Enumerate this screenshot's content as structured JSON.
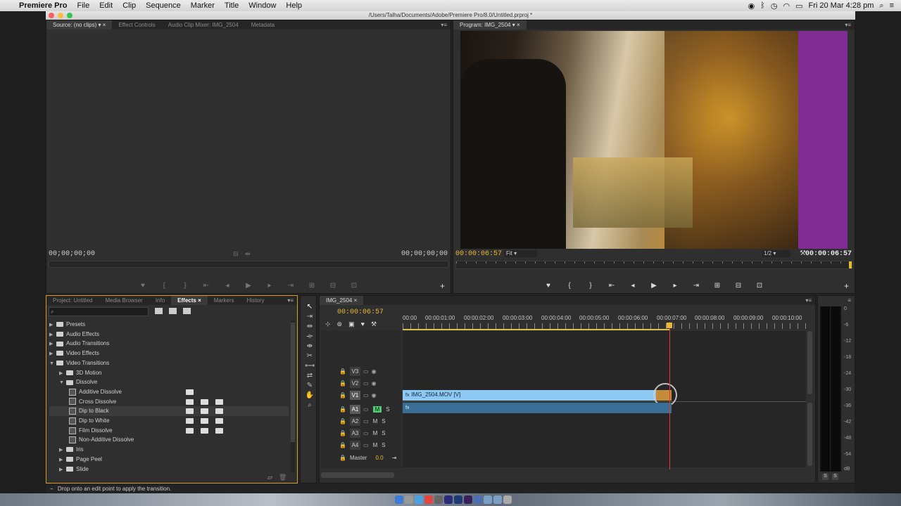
{
  "menubar": {
    "app": "Premiere Pro",
    "items": [
      "File",
      "Edit",
      "Clip",
      "Sequence",
      "Marker",
      "Title",
      "Window",
      "Help"
    ],
    "datetime": "Fri 20 Mar  4:28 pm"
  },
  "window_title": "/Users/Talha/Documents/Adobe/Premiere Pro/8.0/Untitled.prproj *",
  "source_panel": {
    "tabs": [
      "Source: (no clips)",
      "Effect Controls",
      "Audio Clip Mixer: IMG_2504",
      "Metadata"
    ],
    "timecode_in": "00;00;00;00",
    "timecode_out": "00;00;00;00"
  },
  "program_panel": {
    "tab": "Program: IMG_2504",
    "timecode_current": "00:00:06:57",
    "zoom": "Fit",
    "resolution": "1/2",
    "timecode_duration": "00:00:06:57"
  },
  "project_panel": {
    "tabs": [
      "Project: Untitled",
      "Media Browser",
      "Info",
      "Effects",
      "Markers",
      "History"
    ],
    "search_placeholder": "",
    "tree": [
      {
        "label": "Presets",
        "level": 0,
        "expanded": false,
        "type": "folder"
      },
      {
        "label": "Audio Effects",
        "level": 0,
        "expanded": false,
        "type": "folder"
      },
      {
        "label": "Audio Transitions",
        "level": 0,
        "expanded": false,
        "type": "folder"
      },
      {
        "label": "Video Effects",
        "level": 0,
        "expanded": false,
        "type": "folder"
      },
      {
        "label": "Video Transitions",
        "level": 0,
        "expanded": true,
        "type": "folder"
      },
      {
        "label": "3D Motion",
        "level": 1,
        "expanded": false,
        "type": "folder"
      },
      {
        "label": "Dissolve",
        "level": 1,
        "expanded": true,
        "type": "folder"
      },
      {
        "label": "Additive Dissolve",
        "level": 2,
        "type": "effect",
        "badges": 1
      },
      {
        "label": "Cross Dissolve",
        "level": 2,
        "type": "effect",
        "badges": 3
      },
      {
        "label": "Dip to Black",
        "level": 2,
        "type": "effect",
        "badges": 3,
        "selected": true
      },
      {
        "label": "Dip to White",
        "level": 2,
        "type": "effect",
        "badges": 3
      },
      {
        "label": "Film Dissolve",
        "level": 2,
        "type": "effect",
        "badges": 3
      },
      {
        "label": "Non-Additive Dissolve",
        "level": 2,
        "type": "effect",
        "badges": 0
      },
      {
        "label": "Iris",
        "level": 1,
        "expanded": false,
        "type": "folder"
      },
      {
        "label": "Page Peel",
        "level": 1,
        "expanded": false,
        "type": "folder"
      },
      {
        "label": "Slide",
        "level": 1,
        "expanded": false,
        "type": "folder"
      }
    ]
  },
  "timeline": {
    "tab": "IMG_2504",
    "timecode": "00:00:06:57",
    "ruler": [
      "00:00",
      "00:00:01:00",
      "00:00:02:00",
      "00:00:03:00",
      "00:00:04:00",
      "00:00:05:00",
      "00:00:06:00",
      "00:00:07:00",
      "00:00:08:00",
      "00:00:09:00",
      "00:00:10:00"
    ],
    "tracks_video": [
      "V3",
      "V2",
      "V1"
    ],
    "tracks_audio": [
      "A1",
      "A2",
      "A3",
      "A4"
    ],
    "track_m": "M",
    "track_s": "S",
    "master_label": "Master",
    "master_value": "0.0",
    "clip_video": "IMG_2504.MOV [V]",
    "clip_fx": "fx"
  },
  "meter": {
    "labels": [
      "0",
      "-6",
      "-12",
      "-18",
      "-24",
      "-30",
      "-36",
      "-42",
      "-48",
      "-54",
      "dB"
    ],
    "solo": "S"
  },
  "status_text": "Drop onto an edit point to apply the transition.",
  "colors": {
    "accent": "#e8b833",
    "clip_video": "#8ec8f5",
    "clip_audio": "#3b6e96",
    "transition": "#c58a3a",
    "playhead": "#e0402a"
  }
}
